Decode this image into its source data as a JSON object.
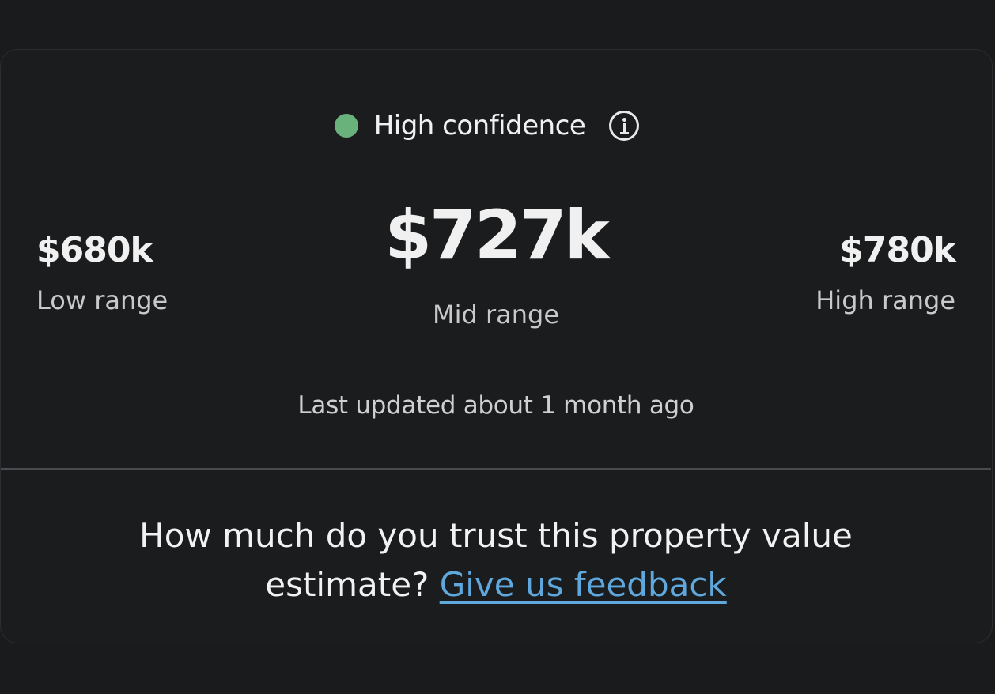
{
  "confidence": {
    "label": "High confidence",
    "dot_color": "#69b27c",
    "info_icon": "info-icon"
  },
  "estimates": {
    "low": {
      "amount": "$680k",
      "label": "Low range"
    },
    "mid": {
      "amount": "$727k",
      "label": "Mid range"
    },
    "high": {
      "amount": "$780k",
      "label": "High range"
    }
  },
  "updated_text": "Last updated about 1 month ago",
  "feedback": {
    "prompt": "How much do you trust this property value estimate? ",
    "link_text": "Give us feedback",
    "link_color": "#5fa8dd"
  }
}
